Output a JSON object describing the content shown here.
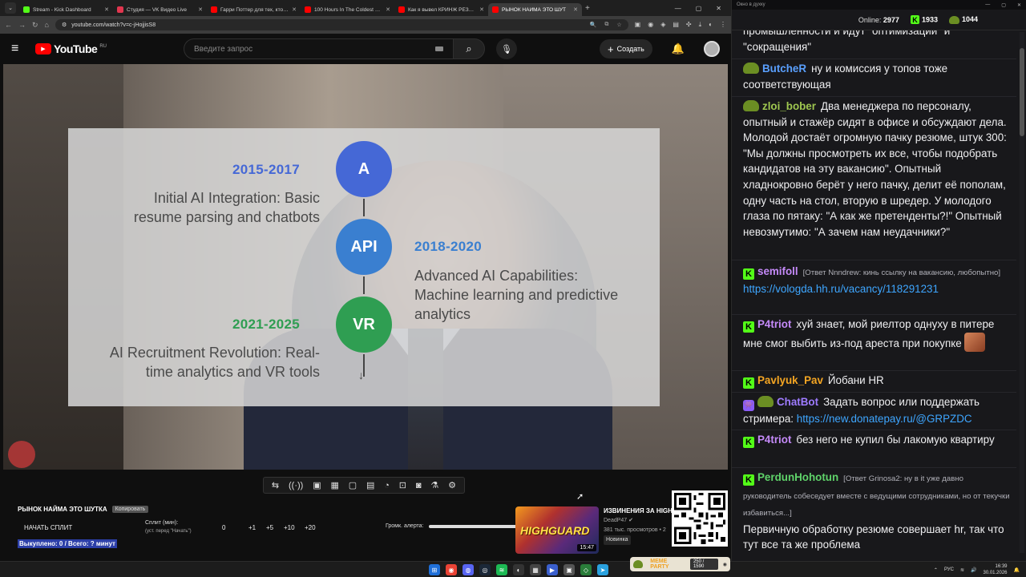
{
  "browser": {
    "tabs": [
      {
        "title": "Stream - Kick Dashboard",
        "color": "#53fc18",
        "active": false
      },
      {
        "title": "Студия — VK Видео Live",
        "color": "#e2364f",
        "active": false
      },
      {
        "title": "Гарри Поттер для тех, кто вы...",
        "color": "#ff0000",
        "active": false
      },
      {
        "title": "100 Hours In The Coldest City",
        "color": "#ff0000",
        "active": false
      },
      {
        "title": "Как я вывел КРИНЖ РЕЗЮМЕ",
        "color": "#ff0000",
        "active": false
      },
      {
        "title": "РЫНОК НАЙМА ЭТО ШУТ",
        "color": "#ff0000",
        "active": true
      }
    ],
    "url": "youtube.com/watch?v=c-jHojjisS8"
  },
  "youtube": {
    "logo_text": "YouTube",
    "region": "RU",
    "search_placeholder": "Введите запрос",
    "create_label": "Создать"
  },
  "slide": {
    "items": [
      {
        "years": "2015-2017",
        "text1": "Initial AI Integration: Basic",
        "text2": "resume parsing and chatbots",
        "icon_text": "A",
        "color": "#4568d6"
      },
      {
        "years": "2018-2020",
        "text1": "Advanced AI Capabilities:",
        "text2": "Machine learning and predictive",
        "text3": "analytics",
        "icon_text": "API",
        "color": "#3a7fd0"
      },
      {
        "years": "2021-2025",
        "text1": "AI Recruitment Revolution: Real-",
        "text2": "time analytics and VR tools",
        "icon_text": "VR",
        "color": "#2f9e52"
      }
    ]
  },
  "stream_panel": {
    "title": "РЫНОК НАЙМА ЭТО ШУТКА",
    "tag": "Копировать",
    "split_button": "НАЧАТЬ СПЛИТ",
    "split_label": "Сплит (мин):",
    "split_sub": "(уст. перед \"Начать\")",
    "split_values": [
      "0",
      "+1",
      "+5",
      "+10",
      "+20"
    ],
    "bought": "Выкуплено: 0 / Всего: ? минут",
    "alert_label": "Громк. алерта:"
  },
  "recommendation": {
    "title": "ИЗВИНЕНИЯ ЗА HIGH",
    "channel": "DeadP47",
    "views": "381 тыс. просмотров • 2",
    "badge": "Новинка",
    "duration": "15:47",
    "thumb_text": "HIGHGUARD"
  },
  "chat": {
    "window_title": "Окно в духку",
    "online_label": "Online:",
    "online_count": "2977",
    "kick_count": "1933",
    "other_count": "1044",
    "messages": [
      {
        "user": "",
        "color": "#efeff1",
        "text": "промышленности и идут \"оптимизации\" и \"сокращения\""
      },
      {
        "user": "ButcheR",
        "color": "#5aa0ff",
        "badge": "frog",
        "text": "ну и комиссия у топов тоже соответствующая"
      },
      {
        "user": "zloi_bober",
        "color": "#9fc750",
        "badge": "frog",
        "text": "Два менеджера по персоналу, опытный и стажёр сидят в офисе и обсуждают дела. Молодой достаёт огромную пачку резюме, штук 300: \"Мы должны просмотреть их все, чтобы подобрать кандидатов на эту вакансию\". Опытный хладнокровно берёт у него пачку, делит её пополам, одну часть на стол, вторую в шредер. У молодого глаза по пятаку: \"А как же претенденты?!\" Опытный невозмутимо: \"А зачем нам неудачники?\""
      },
      {
        "user": "semifoll",
        "color": "#c58af9",
        "badge": "kick",
        "reply": "[Ответ Nnndrew: кинь ссылку на вакансию, любопытно]",
        "link": "https://vologda.hh.ru/vacancy/118291231"
      },
      {
        "user": "P4triot",
        "color": "#c58af9",
        "badge": "kick",
        "text": "хуй знает, мой риелтор однуху в питере мне смог выбить из-под ареста при покупке"
      },
      {
        "user": "Pavlyuk_Pav",
        "color": "#f5a623",
        "badge": "kick",
        "text": "Йобани HR"
      },
      {
        "user": "ChatBot",
        "color": "#9e7bff",
        "badge": "bot",
        "text": "Задать вопрос или поддержать стримера:",
        "link": "https://new.donatepay.ru/@GRPZDC"
      },
      {
        "user": "P4triot",
        "color": "#c58af9",
        "badge": "kick",
        "text": "без него не купил бы лакомую квартиру"
      },
      {
        "user": "PerdunHohotun",
        "color": "#5fd36a",
        "badge": "kick",
        "reply": "[Ответ Grinosa2: ну в it уже давно руководитель собеседует вместе с ведущими сотрудниками, но от текучки избавиться...]",
        "text": "Первичную обработку резюме совершает hr, так что тут все та же проблема"
      }
    ]
  },
  "taskbar": {
    "meme_party": "MEME PARTY",
    "meme_progress": "250 / 1590",
    "lang": "РУС",
    "time": "16:39",
    "date": "30.01.2026"
  }
}
